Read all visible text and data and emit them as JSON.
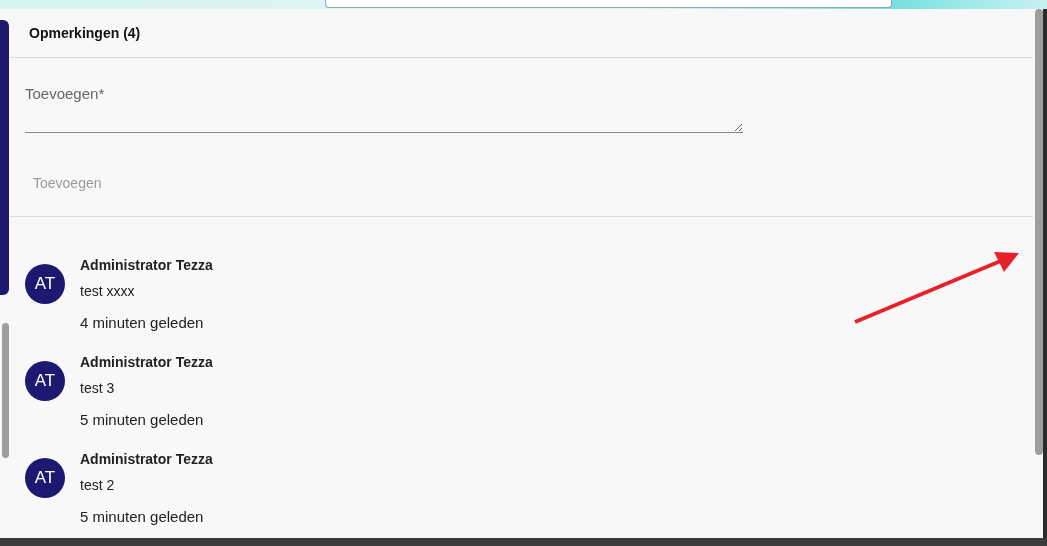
{
  "header": {
    "title": "Opmerkingen (4)"
  },
  "new_comment": {
    "placeholder": "Toevoegen*"
  },
  "add_button": {
    "label": "Toevoegen",
    "disabled": true
  },
  "comments": [
    {
      "initials": "AT",
      "author": "Administrator Tezza",
      "text": "test xxxx",
      "time": "4 minuten geleden"
    },
    {
      "initials": "AT",
      "author": "Administrator Tezza",
      "text": "test 3",
      "time": "5 minuten geleden"
    },
    {
      "initials": "AT",
      "author": "Administrator Tezza",
      "text": "test 2",
      "time": "5 minuten geleden"
    }
  ]
}
